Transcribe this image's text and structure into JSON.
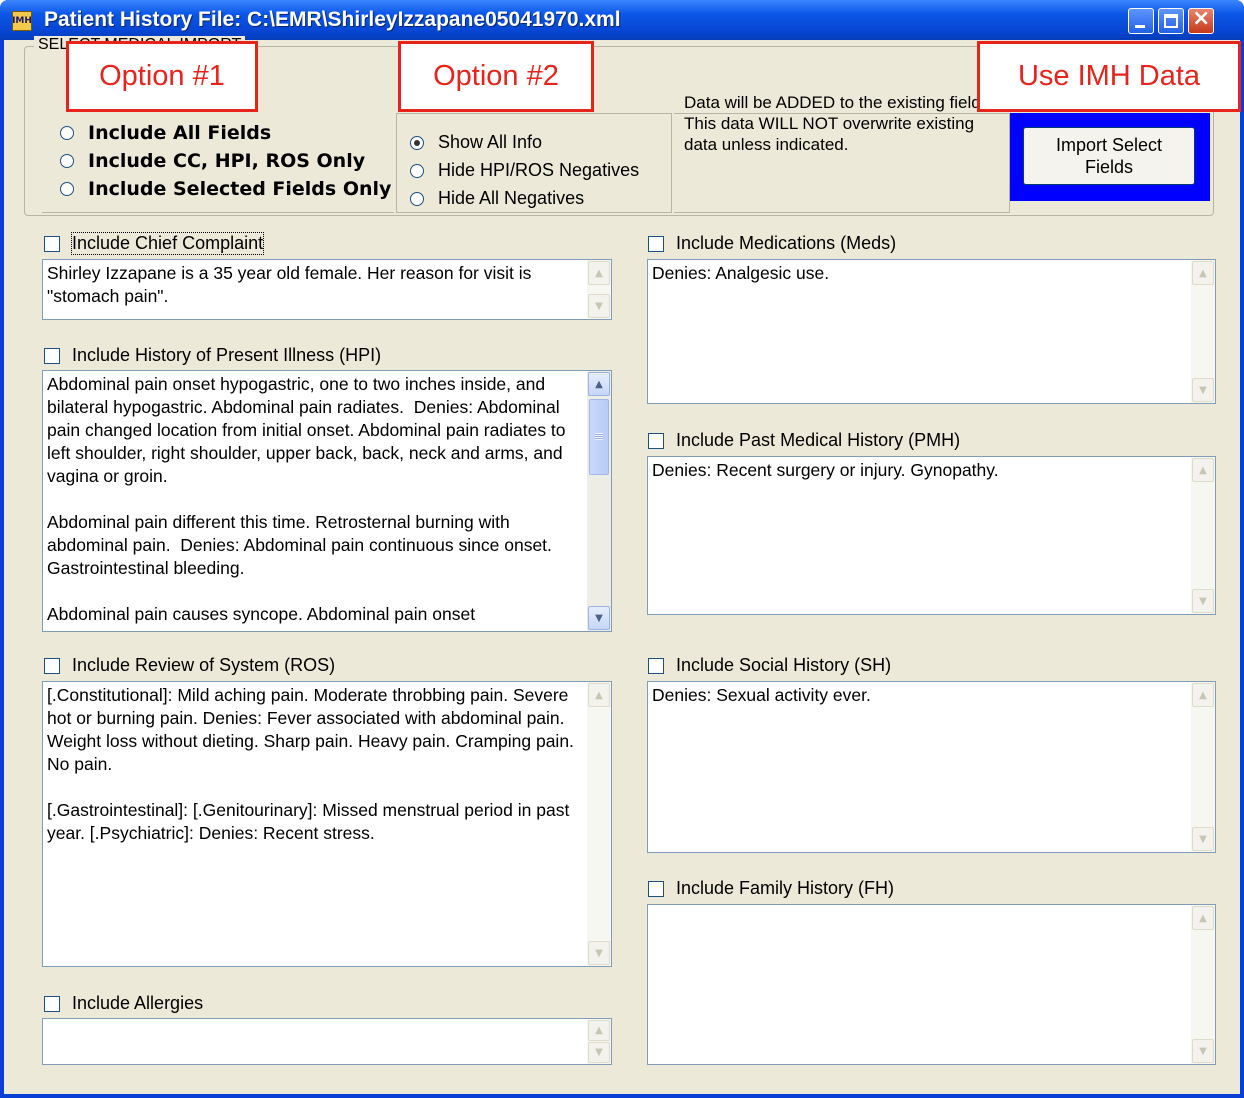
{
  "window": {
    "app_icon_text": "IMH",
    "title": "Patient History File: C:\\EMR\\ShirleyIzzapane05041970.xml"
  },
  "group": {
    "caption": "SELECT MEDICAL IMPORT"
  },
  "option1": {
    "radios": [
      {
        "label": "Include All Fields",
        "selected": false
      },
      {
        "label": "Include CC, HPI, ROS Only",
        "selected": false
      },
      {
        "label": "Include Selected Fields Only",
        "selected": false
      }
    ]
  },
  "option2": {
    "radios": [
      {
        "label": "Show All Info",
        "selected": true
      },
      {
        "label": "Hide HPI/ROS Negatives",
        "selected": false
      },
      {
        "label": "Hide All Negatives",
        "selected": false
      }
    ]
  },
  "info_text": "Data will be ADDED to the existing fields. This data WILL NOT overwrite existing data unless indicated.",
  "import_button": "Import Select\nFields",
  "fields": {
    "chief_complaint": {
      "label": "Include Chief Complaint",
      "checked": false,
      "text": "Shirley Izzapane is a 35 year old female. Her reason for visit is \"stomach pain\"."
    },
    "hpi": {
      "label": "Include History of Present Illness (HPI)",
      "checked": false,
      "text": "Abdominal pain onset hypogastric, one to two inches inside, and bilateral hypogastric. Abdominal pain radiates.  Denies: Abdominal pain changed location from initial onset. Abdominal pain radiates to left shoulder, right shoulder, upper back, back, neck and arms, and vagina or groin.\n\nAbdominal pain different this time. Retrosternal burning with abdominal pain.  Denies: Abdominal pain continuous since onset. Gastrointestinal bleeding.\n\nAbdominal pain causes syncope. Abdominal pain onset"
    },
    "ros": {
      "label": "Include Review of System (ROS)",
      "checked": false,
      "text": "[.Constitutional]: Mild aching pain. Moderate throbbing pain. Severe hot or burning pain. Denies: Fever associated with abdominal pain. Weight loss without dieting. Sharp pain. Heavy pain. Cramping pain. No pain.\n\n[.Gastrointestinal]: [.Genitourinary]: Missed menstrual period in past year. [.Psychiatric]: Denies: Recent stress."
    },
    "allergies": {
      "label": "Include Allergies",
      "checked": false,
      "text": ""
    },
    "medications": {
      "label": "Include Medications (Meds)",
      "checked": false,
      "text": "Denies: Analgesic use."
    },
    "pmh": {
      "label": "Include Past Medical History (PMH)",
      "checked": false,
      "text": "Denies: Recent surgery or injury. Gynopathy."
    },
    "social_history": {
      "label": "Include Social History (SH)",
      "checked": false,
      "text": "Denies: Sexual activity ever."
    },
    "family_history": {
      "label": "Include Family History (FH)",
      "checked": false,
      "text": ""
    }
  },
  "callouts": {
    "option1": "Option #1",
    "option2": "Option #2",
    "use_imh": "Use IMH Data"
  },
  "colors": {
    "titlebar": "#0645d0",
    "dialog_bg": "#ece9d8",
    "callout_red": "#e8231c",
    "import_highlight": "#0000ff"
  }
}
